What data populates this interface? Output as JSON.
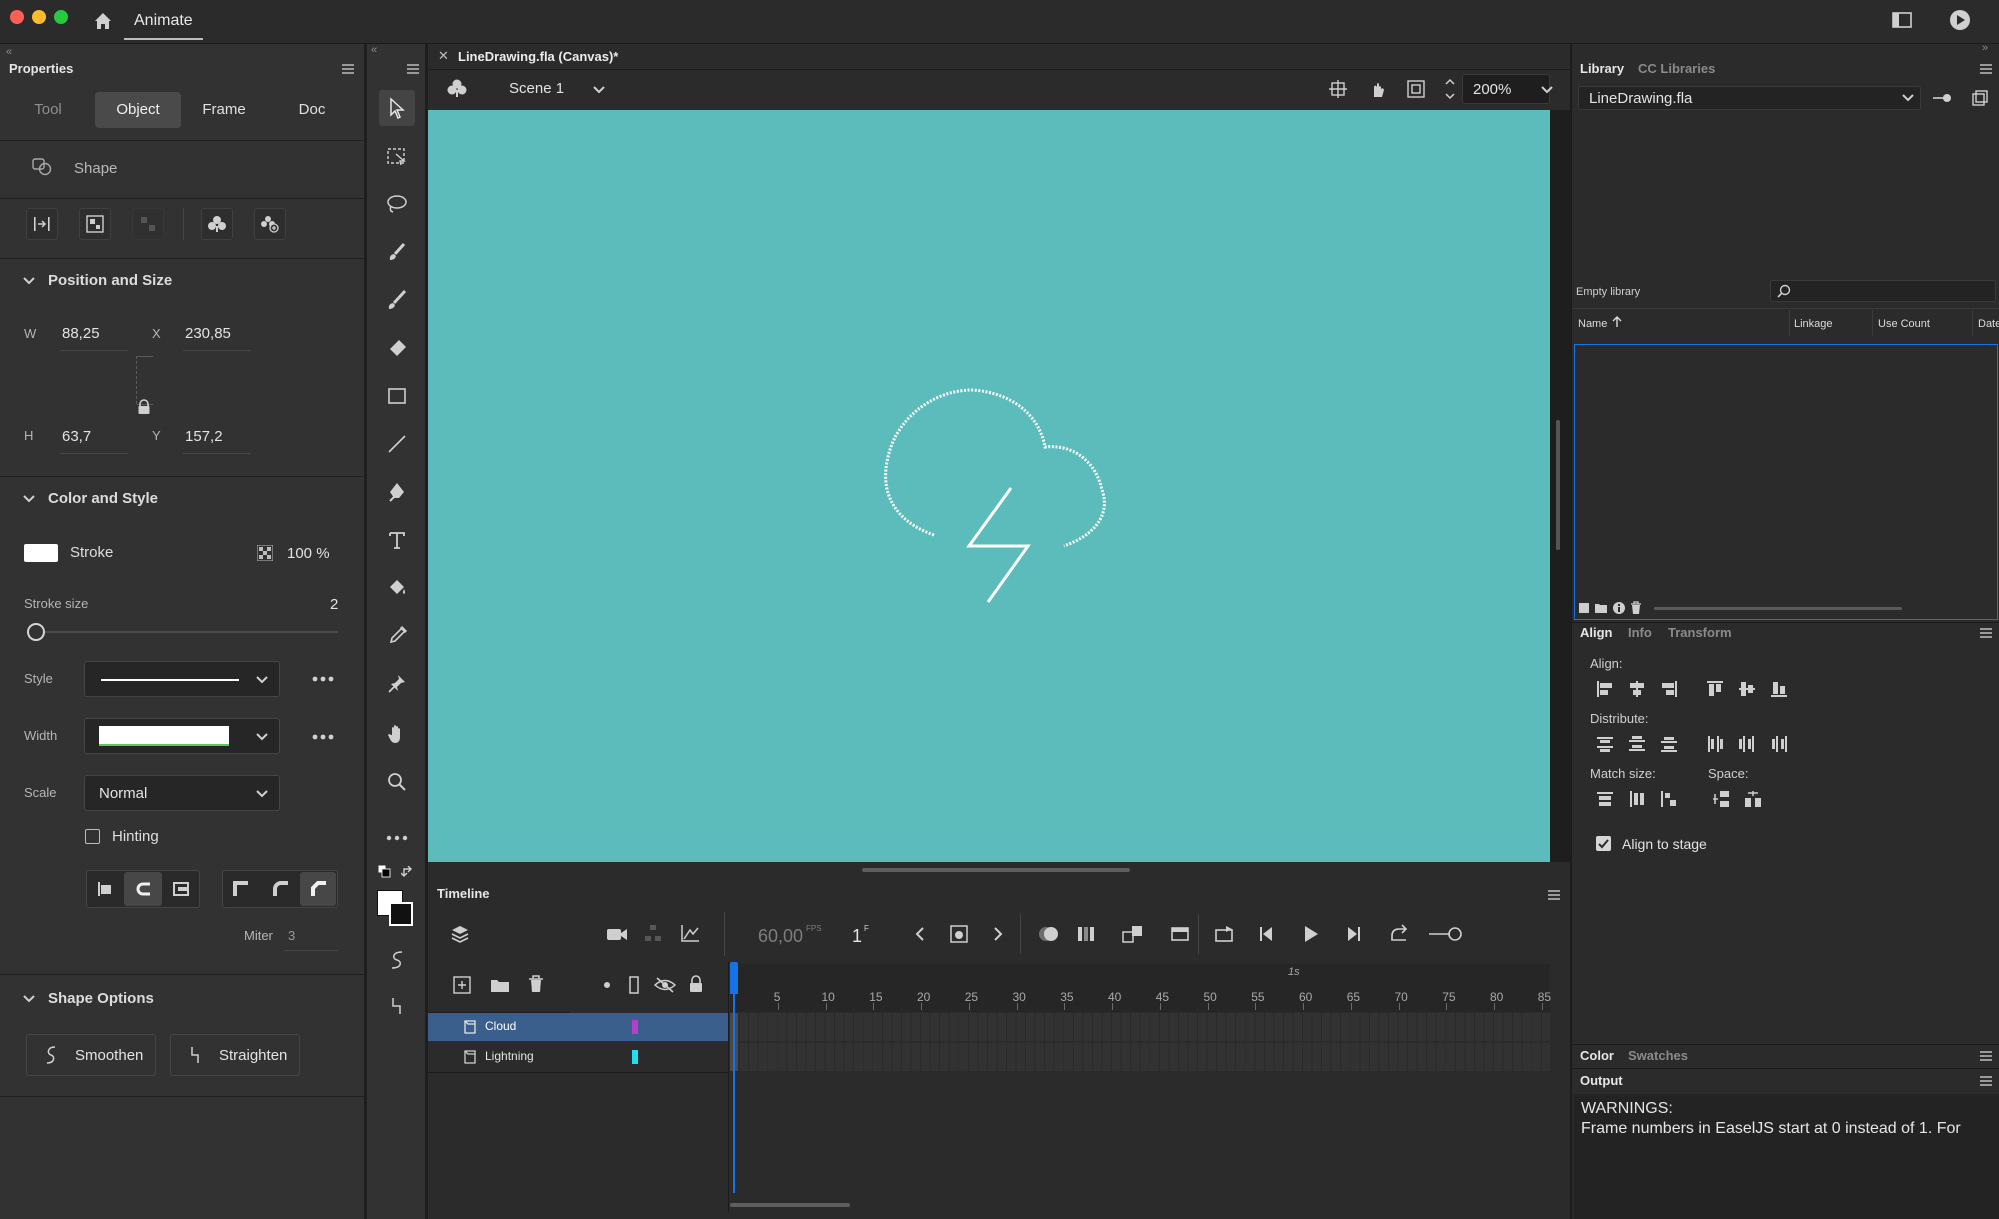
{
  "app": {
    "name": "Animate"
  },
  "document": {
    "tab_title": "LineDrawing.fla (Canvas)*",
    "scene": "Scene 1",
    "zoom": "200%"
  },
  "properties": {
    "title": "Properties",
    "tabs": [
      "Tool",
      "Object",
      "Frame",
      "Doc"
    ],
    "active_tab": "Object",
    "object_type": "Shape",
    "position_size": {
      "title": "Position and Size",
      "w_label": "W",
      "w": "88,25",
      "x_label": "X",
      "x": "230,85",
      "h_label": "H",
      "h": "63,7",
      "y_label": "Y",
      "y": "157,2"
    },
    "color_style": {
      "title": "Color and Style",
      "stroke_label": "Stroke",
      "stroke_color": "#ffffff",
      "stroke_alpha": "100 %",
      "stroke_size_label": "Stroke size",
      "stroke_size": "2",
      "style_label": "Style",
      "width_label": "Width",
      "scale_label": "Scale",
      "scale_value": "Normal",
      "hinting_label": "Hinting",
      "hinting_checked": false,
      "miter_label": "Miter",
      "miter_value": "3"
    },
    "shape_options": {
      "title": "Shape Options",
      "smoothen_label": "Smoothen",
      "straighten_label": "Straighten"
    }
  },
  "timeline": {
    "title": "Timeline",
    "fps": "60,00",
    "fps_unit": "FPS",
    "current_frame": "1",
    "frame_unit": "F",
    "second_marker": "1s",
    "ticks": [
      "5",
      "10",
      "15",
      "20",
      "25",
      "30",
      "35",
      "40",
      "45",
      "50",
      "55",
      "60",
      "65",
      "70",
      "75",
      "80",
      "85"
    ],
    "layers": [
      {
        "name": "Cloud",
        "color": "#b340c8",
        "selected": true
      },
      {
        "name": "Lightning",
        "color": "#1fe0f0",
        "selected": false
      }
    ]
  },
  "library": {
    "tab_library": "Library",
    "tab_cc": "CC Libraries",
    "file": "LineDrawing.fla",
    "empty_label": "Empty library",
    "columns": [
      "Name",
      "Linkage",
      "Use Count",
      "Date"
    ]
  },
  "align": {
    "tabs": [
      "Align",
      "Info",
      "Transform"
    ],
    "align_label": "Align:",
    "distribute_label": "Distribute:",
    "match_size_label": "Match size:",
    "space_label": "Space:",
    "align_to_stage_label": "Align to stage",
    "align_to_stage_checked": true
  },
  "color_panel": {
    "tabs": [
      "Color",
      "Swatches"
    ]
  },
  "output": {
    "title": "Output",
    "lines": [
      "WARNINGS:",
      "Frame numbers in EaselJS start at 0 instead of 1. For"
    ]
  },
  "colors": {
    "stage": "#5bbcbb",
    "accent": "#1473e6",
    "layer_selected": "#3a5f8c"
  }
}
